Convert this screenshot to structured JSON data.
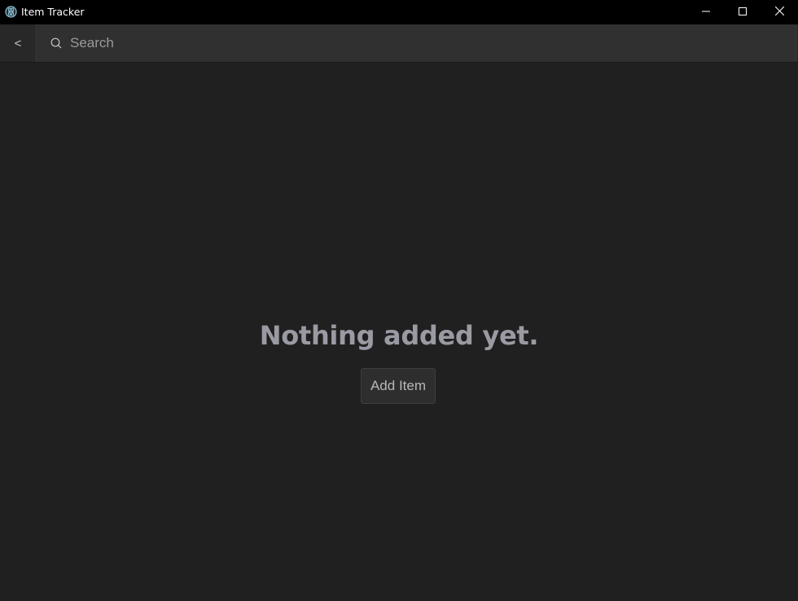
{
  "window": {
    "title": "Item Tracker",
    "app_icon": "app-logo-icon",
    "controls": [
      "minimize-icon",
      "maximize-icon",
      "close-icon"
    ]
  },
  "toolbar": {
    "back_label": "<",
    "search": {
      "placeholder": "Search",
      "value": "",
      "icon": "search-icon"
    }
  },
  "empty_state": {
    "message": "Nothing added yet.",
    "button_label": "Add Item"
  },
  "colors": {
    "titlebar": "#000000",
    "background": "#202020",
    "toolbar": "#2a2a2a",
    "search_bg": "#303030",
    "message_text": "#9a9aa3",
    "button_bg": "#2e2e2e"
  }
}
